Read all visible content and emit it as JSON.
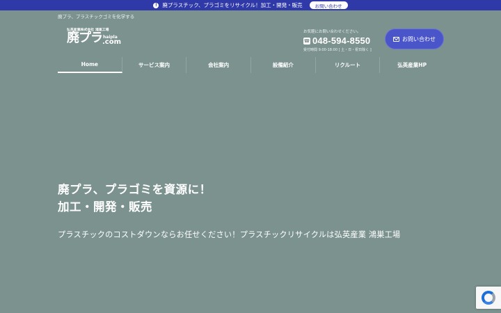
{
  "notice": {
    "icon": "info-icon",
    "text": "廃プラスチック、プラゴミをリサイクル！加工・開発・販売",
    "button_label": "お問い合わせ"
  },
  "header": {
    "tagline": "廃プラ、プラスチックゴミを化学する",
    "logo": {
      "company": "弘英産業株式会社 鴻巣工場",
      "mark": "廃プラ",
      "sub": "haipla",
      "com": ".com"
    },
    "contact": {
      "lead": "お気軽にお問い合わせください。",
      "phone_icon": "phone-icon",
      "phone": "048-594-8550",
      "hours": "受付時間 9:00-18:00 [ 土・日・祝日除く ]",
      "button_label": "お問い合わせ",
      "button_icon": "mail-icon"
    }
  },
  "nav": {
    "items": [
      {
        "label": "Home"
      },
      {
        "label": "サービス案内"
      },
      {
        "label": "会社案内"
      },
      {
        "label": "設備紹介"
      },
      {
        "label": "リクルート"
      },
      {
        "label": "弘英産業HP"
      }
    ],
    "active_index": 0
  },
  "hero": {
    "title_line1": "廃プラ、プラゴミを資源に！",
    "title_line2": "加工・開発・販売",
    "subtitle": "プラスチックのコストダウンならお任せください！プラスチックリサイクルは弘英産業 鴻巣工場"
  },
  "colors": {
    "background": "#7b928f",
    "notice_bar": "#2f3aa8",
    "accent_button": "#4a55c9"
  },
  "recaptcha": {
    "icon": "recaptcha-icon"
  }
}
